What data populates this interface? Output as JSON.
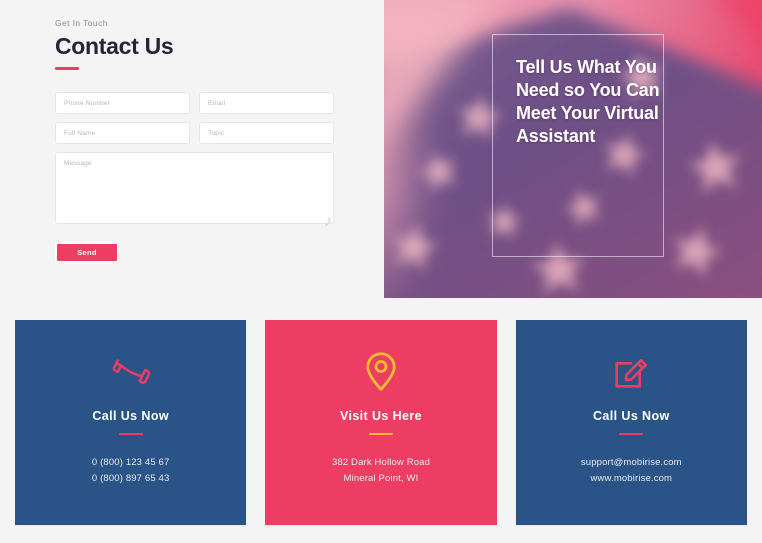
{
  "theme": {
    "page_background": "#f4f4f5",
    "accent_pink": "#ee3d63",
    "card_blue": "#2a5387",
    "card_pink": "#ee3d63",
    "accent_yellow": "#f5bd34",
    "heading_color": "#232437"
  },
  "contact": {
    "eyebrow": "Get In Touch",
    "title": "Contact Us",
    "fields": {
      "phone_placeholder": "Phone Number",
      "phone_value": "",
      "email_placeholder": "Email",
      "email_value": "",
      "name_placeholder": "Full Name",
      "name_value": "",
      "topic_placeholder": "Topic",
      "topic_value": "",
      "message_placeholder": "Message",
      "message_value": ""
    },
    "submit_label": "Send"
  },
  "hero": {
    "headline": "Tell Us What You Need so You Can Meet Your Virtual Assistant",
    "image_description": "blurred american flag stars"
  },
  "cards": [
    {
      "icon": "phone-icon",
      "title": "Call Us Now",
      "lines": [
        "0 (800) 123 45 67",
        "0 (800) 897 65 43"
      ],
      "style": "blue"
    },
    {
      "icon": "map-pin-icon",
      "title": "Visit Us Here",
      "lines": [
        "382 Dark Hollow Road",
        "Mineral Point, WI"
      ],
      "style": "pink"
    },
    {
      "icon": "edit-icon",
      "title": "Call Us Now",
      "lines": [
        "support@mobirise.com",
        "www.mobirise.com"
      ],
      "style": "blue"
    }
  ]
}
